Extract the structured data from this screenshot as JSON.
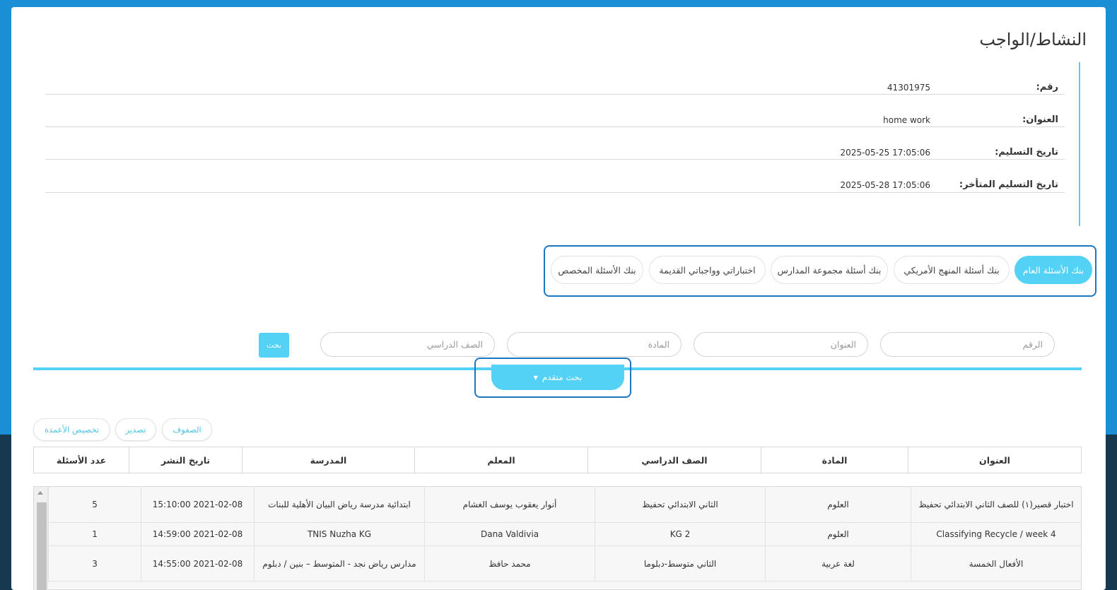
{
  "page": {
    "title": "النشاط/الواجب"
  },
  "details": [
    {
      "label": "رقم:",
      "value": "41301975"
    },
    {
      "label": "العنوان:",
      "value": "home work"
    },
    {
      "label": "تاريخ التسليم:",
      "value": "2025-05-25 17:05:06"
    },
    {
      "label": "تاريخ التسليم المتأخر:",
      "value": "2025-05-28 17:05:06"
    }
  ],
  "tabs": [
    {
      "label": "بنك الأسئلة العام",
      "active": true
    },
    {
      "label": "بنك أسئلة المنهج الأمريكي",
      "active": false
    },
    {
      "label": "بنك أسئلة مجموعة المدارس",
      "active": false
    },
    {
      "label": "اختباراتي وواجباتي القديمة",
      "active": false
    },
    {
      "label": "بنك الأسئلة المخصص",
      "active": false
    }
  ],
  "search": {
    "number_placeholder": "الرقم",
    "title_placeholder": "العنوان",
    "subject_placeholder": "المادة",
    "grade_placeholder": "الصف الدراسي",
    "search_button": "بحث",
    "advanced_button": "بحث متقدم"
  },
  "toolbar": {
    "rows": "الصفوف",
    "export": "تصدير",
    "customize_columns": "تخصيص الأعمدة"
  },
  "table": {
    "headers": [
      "العنوان",
      "المادة",
      "الصف الدراسي",
      "المعلم",
      "المدرسة",
      "تاريخ النشر",
      "عدد الأسئلة"
    ],
    "rows": [
      [
        "اختبار قصير(١) للصف الثاني الابتدائي تحفيظ",
        "العلوم",
        "الثاني الابتدائي تحفيظ",
        "أنوار يعقوب يوسف الغشام",
        "ابتدائية مدرسة رياض البيان الأهلية للبنات",
        "2021-02-08 15:10:00",
        "5"
      ],
      [
        "Classifying Recycle / week 4",
        "العلوم",
        "KG 2",
        "Dana Valdivia",
        "TNIS Nuzha KG",
        "2021-02-08 14:59:00",
        "1"
      ],
      [
        "الأفعال الخمسة",
        "لغة عربية",
        "الثاني متوسط-دبلوما",
        "محمد حافظ",
        "مدارس رياض نجد - المتوسط – بنين / دبلوم",
        "2021-02-08 14:55:00",
        "3"
      ]
    ]
  },
  "colors": {
    "accent": "#53d2f5",
    "highlight_frame": "#1e75c0",
    "background": "#1a8fd6"
  }
}
